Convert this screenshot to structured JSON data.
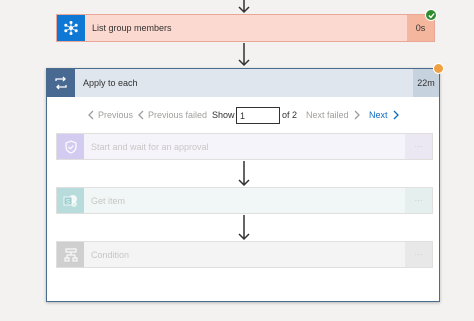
{
  "flow": {
    "list_group_members": {
      "label": "List group members",
      "duration": "0s",
      "status": "success",
      "icon": "azure-ad-icon"
    },
    "apply_to_each": {
      "label": "Apply to each",
      "duration": "22m",
      "status": "warning",
      "icon": "loop-icon"
    },
    "pager": {
      "previous": "Previous",
      "previous_failed": "Previous failed",
      "show": "Show",
      "current": "1",
      "of_total": "of 2",
      "next_failed": "Next failed",
      "next": "Next"
    },
    "inner_actions": [
      {
        "label": "Start and wait for an approval",
        "more": "···",
        "icon": "approval-icon"
      },
      {
        "label": "Get item",
        "more": "···",
        "icon": "sharepoint-icon"
      },
      {
        "label": "Condition",
        "more": "···",
        "icon": "condition-icon"
      }
    ]
  },
  "colors": {
    "accent": "#0f6cbd",
    "success": "#2e8b2e",
    "warning": "#f0a040",
    "failed_bg": "#fbd9d0"
  }
}
